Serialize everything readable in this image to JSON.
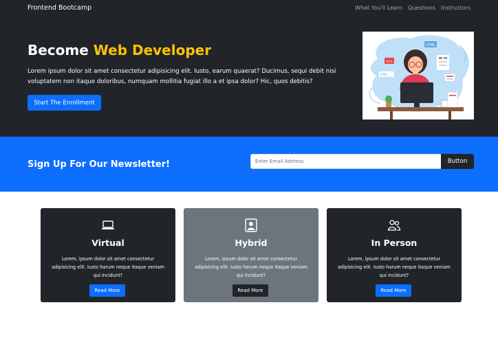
{
  "navbar": {
    "brand": "Frontend Bootcamp",
    "links": [
      "What You'll Learn",
      "Questions",
      "Instructors"
    ]
  },
  "hero": {
    "title_prefix": "Become ",
    "title_accent": "Web Developer",
    "text": "Lorem ipsum dolor sit amet consectetur adipisicing elit. Iusto, earum quaerat? Ducimus, sequi debit nisi voluptatem non itaque doloribus, numquam mollitia fugiat illo a et ipsa dolor? Hic, quos debitis?",
    "button": "Start The Enrollment",
    "illustration_labels": [
      "HTML",
      "CSS",
      "</>"
    ]
  },
  "newsletter": {
    "title": "Sign Up For Our Newsletter!",
    "placeholder": "Enter Email Address",
    "button": "Button"
  },
  "cards": [
    {
      "icon": "laptop-icon",
      "title": "Virtual",
      "text": "Lorem, ipsum dolor sit amet consectetur adipisicing elit. Iusto harum neque itaque veniam qui incidunt?",
      "button": "Read More"
    },
    {
      "icon": "person-badge-icon",
      "title": "Hybrid",
      "text": "Lorem, ipsum dolor sit amet consectetur adipisicing elit. Iusto harum neque itaque veniam qui incidunt?",
      "button": "Read More"
    },
    {
      "icon": "people-icon",
      "title": "In Person",
      "text": "Lorem, ipsum dolor sit amet consectetur adipisicing elit. Iusto harum neque itaque veniam qui incidunt?",
      "button": "Read More"
    }
  ],
  "colors": {
    "dark": "#212529",
    "primary": "#0d6efd",
    "accent": "#ffc107",
    "secondary": "#6c757d"
  }
}
